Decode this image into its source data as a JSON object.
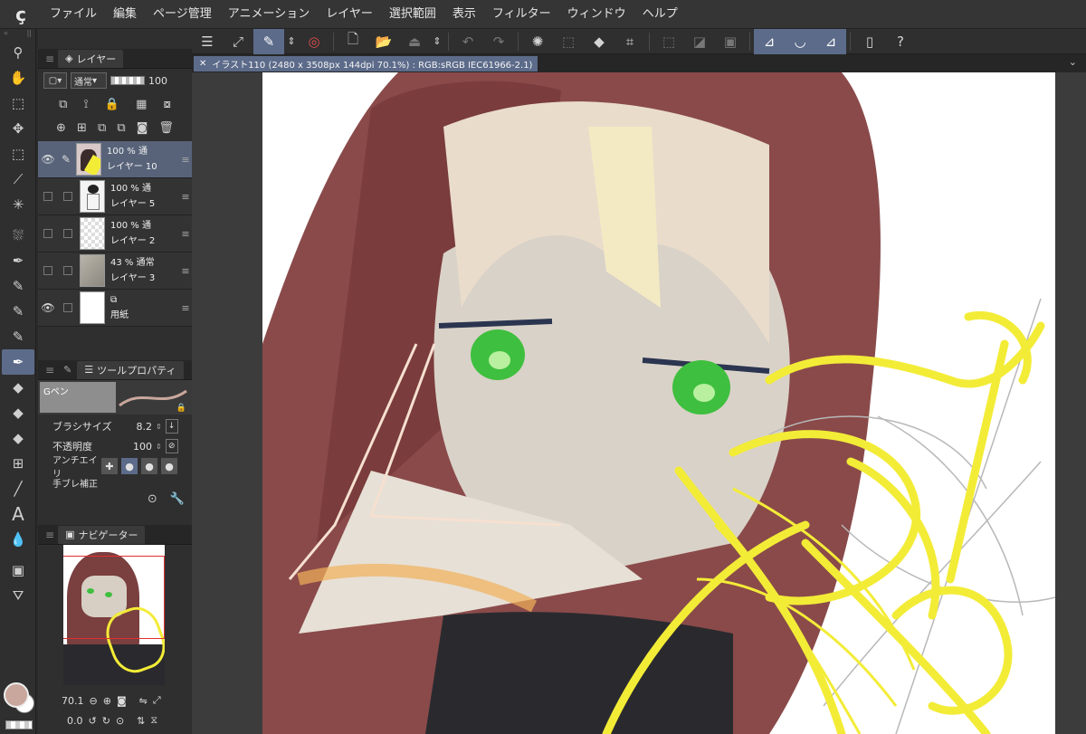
{
  "menu": {
    "items": [
      "ファイル",
      "編集",
      "ページ管理",
      "アニメーション",
      "レイヤー",
      "選択範囲",
      "表示",
      "フィルター",
      "ウィンドウ",
      "ヘルプ"
    ]
  },
  "layer_panel": {
    "tab_label": "レイヤー",
    "blend_mode": "通常",
    "opacity": "100",
    "layers": [
      {
        "opacity": "100 %",
        "mode": "通",
        "name": "レイヤー 10",
        "visible": true,
        "selected": true
      },
      {
        "opacity": "100 %",
        "mode": "通",
        "name": "レイヤー 5",
        "visible": false,
        "selected": false
      },
      {
        "opacity": "100 %",
        "mode": "通",
        "name": "レイヤー 2",
        "visible": false,
        "selected": false
      },
      {
        "opacity": "43 %",
        "mode": "通常",
        "name": "レイヤー 3",
        "visible": false,
        "selected": false
      },
      {
        "opacity": "",
        "mode": "",
        "name": "用紙",
        "visible": true,
        "selected": false
      }
    ]
  },
  "tool_property": {
    "tab_label": "ツールプロパティ",
    "brush_name": "Gペン",
    "brush_size_label": "ブラシサイズ",
    "brush_size": "8.2",
    "opacity_label": "不透明度",
    "opacity": "100",
    "antialias_label": "アンチエイリ",
    "stabilization_label": "手ブレ補正"
  },
  "navigator": {
    "tab_label": "ナビゲーター",
    "zoom": "70.1",
    "rotation": "0.0"
  },
  "canvas": {
    "tab_title": "イラスト110 (2480 x 3508px 144dpi 70.1%) : RGB:sRGB IEC61966-2.1)"
  },
  "colors": {
    "accent": "#5c6b8a",
    "main_color": "#c9a79c",
    "sub_color": "#ffffff",
    "hair": "#8a4a4a",
    "eyes": "#3fbf3f",
    "sketch_yellow": "#f3ec37"
  }
}
